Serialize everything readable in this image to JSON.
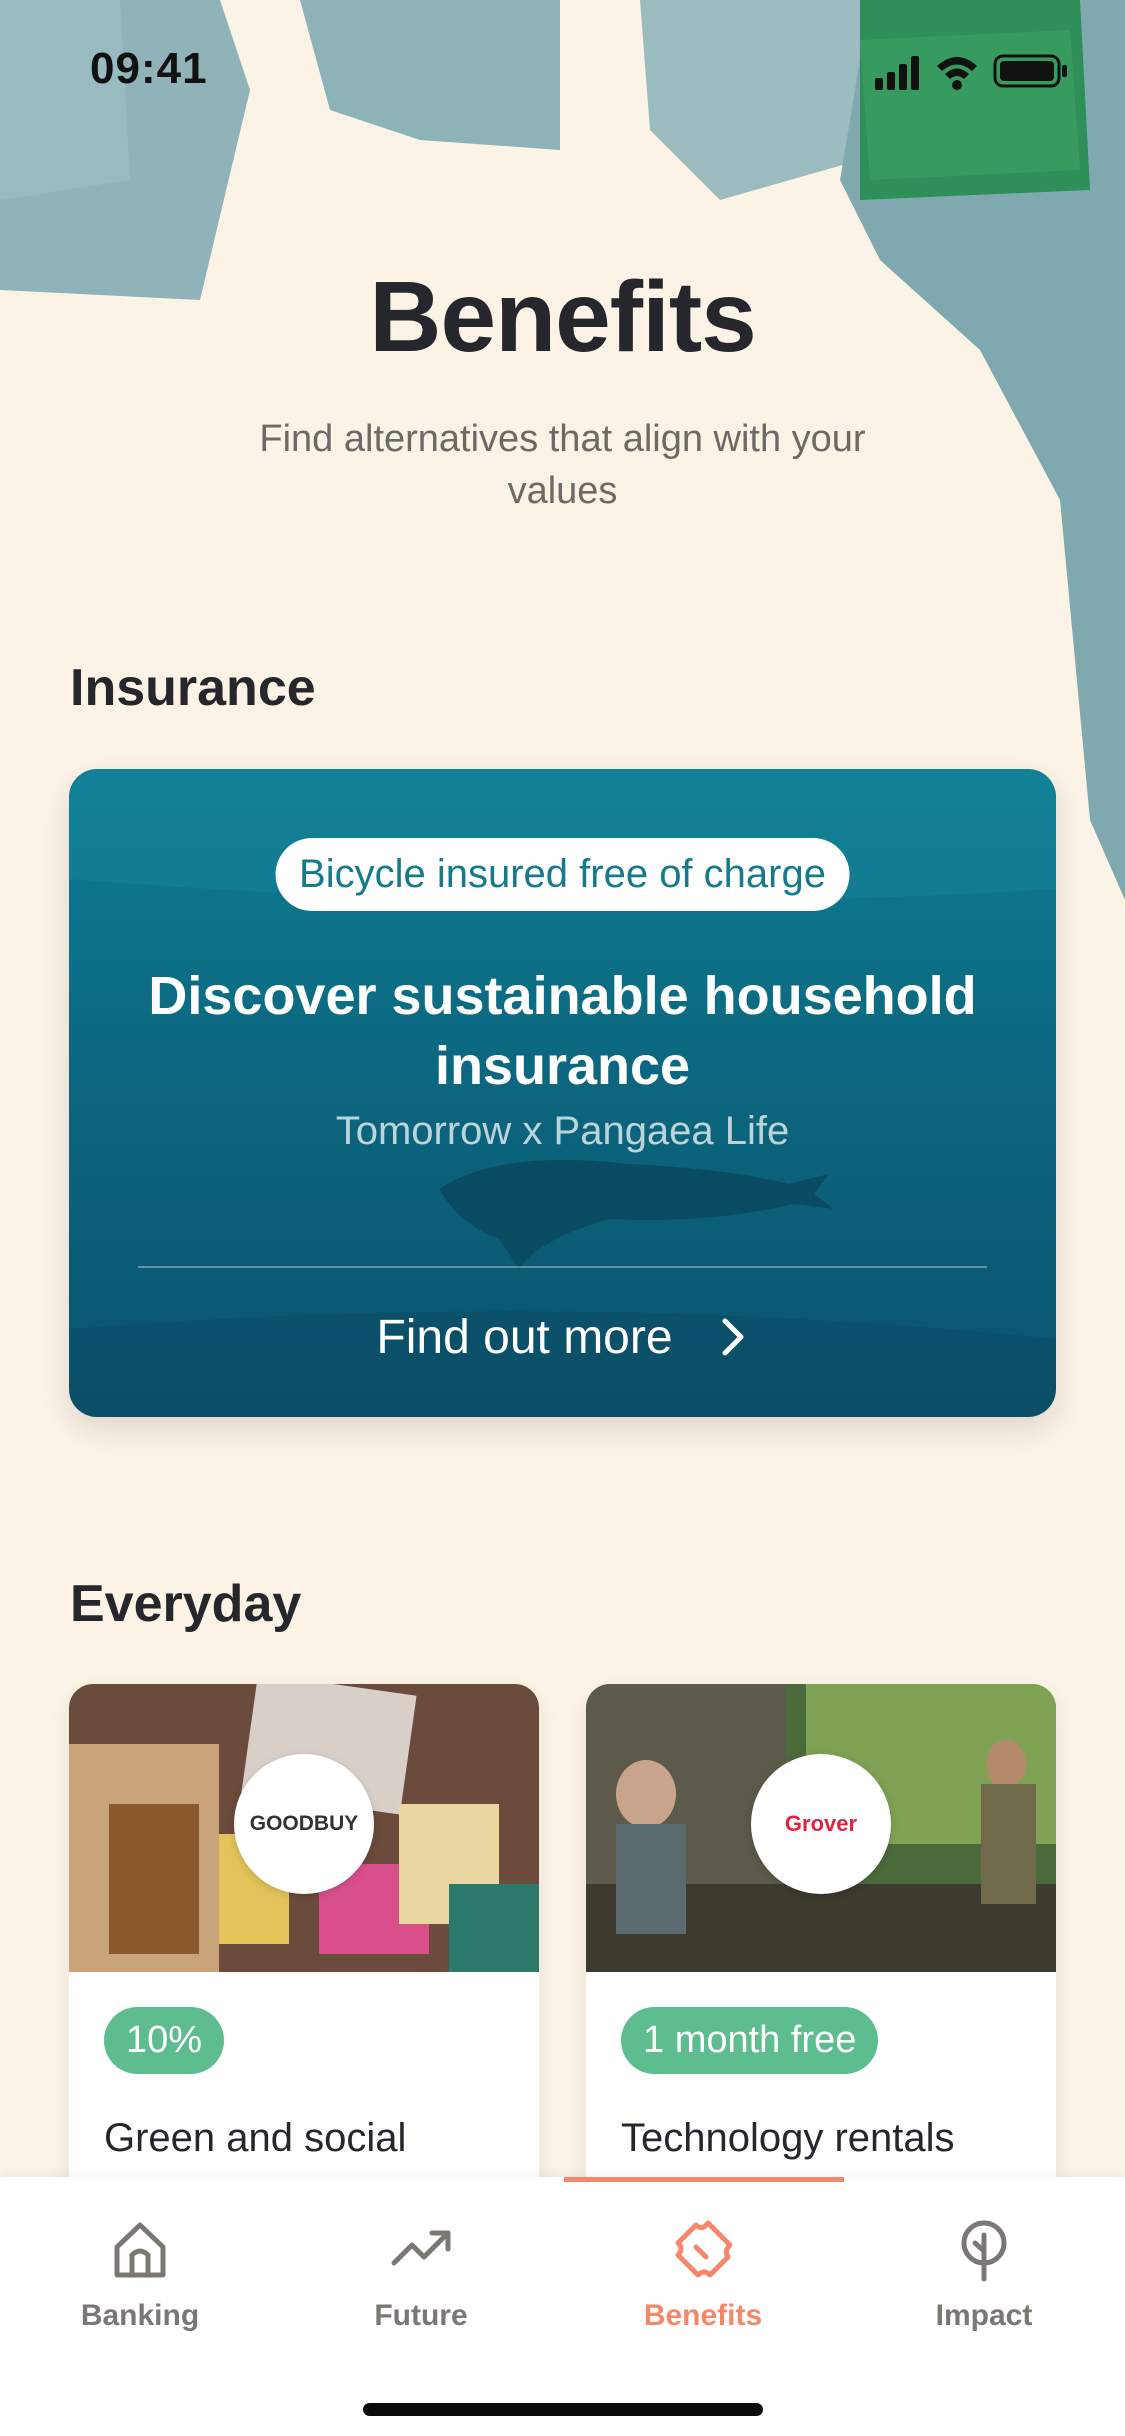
{
  "status_bar": {
    "time": "09:41"
  },
  "header": {
    "title": "Benefits",
    "subtitle": "Find alternatives that align with your values"
  },
  "sections": {
    "insurance": {
      "title": "Insurance",
      "card": {
        "badge": "Bicycle insured free of charge",
        "title": "Discover sustainable household insurance",
        "partner": "Tomorrow x Pangaea Life",
        "cta": "Find out more"
      }
    },
    "everyday": {
      "title": "Everyday",
      "offers": [
        {
          "logo": "GOODBUY",
          "tag": "10%",
          "label": "Green and social products"
        },
        {
          "logo": "Grover",
          "tag": "1 month free",
          "label": "Technology rentals"
        }
      ]
    }
  },
  "tab_bar": {
    "active": "Benefits",
    "tabs": [
      {
        "label": "Banking",
        "icon": "home-icon"
      },
      {
        "label": "Future",
        "icon": "trend-up-icon"
      },
      {
        "label": "Benefits",
        "icon": "ticket-icon"
      },
      {
        "label": "Impact",
        "icon": "tree-icon"
      }
    ]
  },
  "colors": {
    "background": "#fbf3e6",
    "accent": "#f5876b",
    "tag_green": "#5dbd8f",
    "card_teal": "#0b6880"
  }
}
